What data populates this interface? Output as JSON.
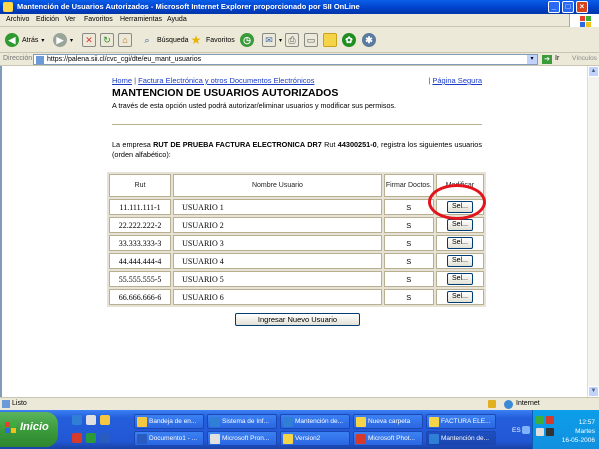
{
  "window": {
    "title": "Mantención de Usuarios Autorizados - Microsoft Internet Explorer proporcionado por SII OnLine",
    "controls": [
      "_",
      "□",
      "×"
    ]
  },
  "menu": [
    "Archivo",
    "Edición",
    "Ver",
    "Favoritos",
    "Herramientas",
    "Ayuda"
  ],
  "toolbar": {
    "back": "Atrás",
    "search": "Búsqueda",
    "favorites": "Favoritos"
  },
  "address": {
    "label": "Dirección",
    "url": "https://palena.sii.cl/cvc_cgi/dte/eu_mant_usuarios",
    "go": "Ir",
    "links": "Vínculos"
  },
  "page": {
    "nav": {
      "home": "Home",
      "sep1": "|",
      "facturacion": "Factura Electrónica y otros Documentos Electrónicos",
      "sep2": "|",
      "segura": "Página Segura"
    },
    "title": "MANTENCION DE USUARIOS AUTORIZADOS",
    "subtitle": "A través de esta opción usted podrá autorizar/eliminar usuarios y modificar sus permisos.",
    "intro": {
      "pre": "La empresa",
      "company": "RUT DE PRUEBA FACTURA ELECTRONICA DR7",
      "mid": "Rut",
      "rut": "44300251-0",
      "post": ", registra los siguientes usuarios (orden alfabético):"
    },
    "table": {
      "headers": {
        "rut": "Rut",
        "nombre": "Nombre Usuario",
        "firmar": "Firmar Doctos.",
        "modificar": "Modificar"
      },
      "rows": [
        {
          "rut": "11.111.111-1",
          "nombre": "USUARIO 1",
          "firmar": "S",
          "btn": "Sel..."
        },
        {
          "rut": "22.222.222-2",
          "nombre": "USUARIO 2",
          "firmar": "S",
          "btn": "Sel..."
        },
        {
          "rut": "33.333.333-3",
          "nombre": "USUARIO 3",
          "firmar": "S",
          "btn": "Sel..."
        },
        {
          "rut": "44.444.444-4",
          "nombre": "USUARIO 4",
          "firmar": "S",
          "btn": "Sel..."
        },
        {
          "rut": "55.555.555-5",
          "nombre": "USUARIO 5",
          "firmar": "S",
          "btn": "Sel..."
        },
        {
          "rut": "66.666.666-6",
          "nombre": "USUARIO 6",
          "firmar": "S",
          "btn": "Sel..."
        }
      ]
    },
    "new_user_button": "Ingresar Nuevo Usuario"
  },
  "status": {
    "text": "Listo",
    "zone": "Internet"
  },
  "taskbar": {
    "start": "Inicio",
    "tasks_row1": [
      "Bandeja de en...",
      "Sistema de Inf...",
      "Mantención de...",
      "Nueva carpeta",
      "FACTURA ELE..."
    ],
    "tasks_row2": [
      "Documento1 - ...",
      "Microsoft Pron...",
      "Version2",
      "Microsoft Phot...",
      "Mantención de..."
    ],
    "lang": "ES",
    "clock": {
      "time": "12:57",
      "day": "Martes",
      "date": "16-05-2006"
    }
  },
  "colors": {
    "link": "#1a3cc8",
    "highlight_circle": "#e2141c",
    "titlebar": "#0a5ee9"
  }
}
